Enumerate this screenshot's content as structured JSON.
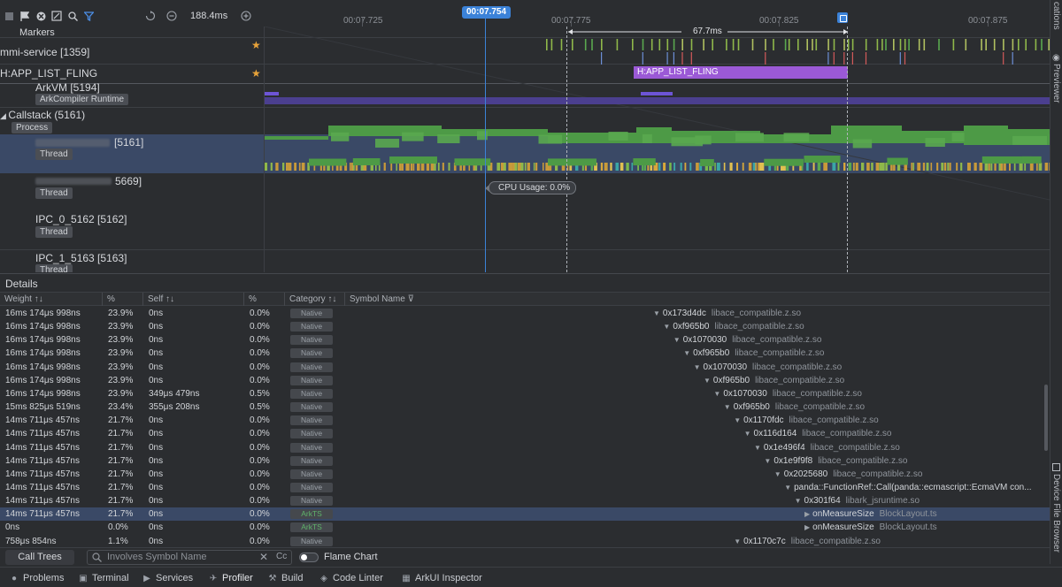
{
  "toolbar": {
    "zoom_value": "188.4ms",
    "icons": [
      "stop-icon",
      "flag-icon",
      "clear-icon",
      "fit-icon",
      "search-icon",
      "filter-icon",
      "reset-icon",
      "zoom-out-icon",
      "zoom-in-icon"
    ]
  },
  "ruler": {
    "cursor_time": "00:07.754",
    "ticks": [
      "00:07.725",
      "00:07.775",
      "00:07.825",
      "00:07.875"
    ],
    "duration": "67.7ms"
  },
  "lanes": {
    "markers": "Markers",
    "mmi_service": "mmi-service [1359]",
    "app_list_fling": "H:APP_LIST_FLING",
    "arkvm": "ArkVM [5194]",
    "arkvm_tag": "ArkCompiler Runtime",
    "callstack": "Callstack (5161)",
    "callstack_tag": "Process",
    "thread1_id": "[5161]",
    "thread1_tag": "Thread",
    "thread2_id": "5669]",
    "thread2_tag": "Thread",
    "ipc0": "IPC_0_5162 [5162]",
    "ipc0_tag": "Thread",
    "ipc1": "IPC_1_5163 [5163]",
    "ipc1_tag": "Thread"
  },
  "fling_label": "H:APP_LIST_FLING",
  "cpu_usage": "CPU Usage:  0.0%",
  "details": {
    "title": "Details",
    "columns": [
      "Weight ↑↓",
      "%",
      "Self ↑↓",
      "%",
      "Category ↑↓",
      "Symbol Name ⊽"
    ],
    "rows": [
      {
        "weight": "16ms 174μs 998ns",
        "pct": "23.9%",
        "self": "0ns",
        "spct": "0.0%",
        "cat": "Native",
        "sym": "0x173d4dc",
        "lib": "libace_compatible.z.so",
        "indent": 0
      },
      {
        "weight": "16ms 174μs 998ns",
        "pct": "23.9%",
        "self": "0ns",
        "spct": "0.0%",
        "cat": "Native",
        "sym": "0xf965b0",
        "lib": "libace_compatible.z.so",
        "indent": 1
      },
      {
        "weight": "16ms 174μs 998ns",
        "pct": "23.9%",
        "self": "0ns",
        "spct": "0.0%",
        "cat": "Native",
        "sym": "0x1070030",
        "lib": "libace_compatible.z.so",
        "indent": 2
      },
      {
        "weight": "16ms 174μs 998ns",
        "pct": "23.9%",
        "self": "0ns",
        "spct": "0.0%",
        "cat": "Native",
        "sym": "0xf965b0",
        "lib": "libace_compatible.z.so",
        "indent": 3
      },
      {
        "weight": "16ms 174μs 998ns",
        "pct": "23.9%",
        "self": "0ns",
        "spct": "0.0%",
        "cat": "Native",
        "sym": "0x1070030",
        "lib": "libace_compatible.z.so",
        "indent": 4
      },
      {
        "weight": "16ms 174μs 998ns",
        "pct": "23.9%",
        "self": "0ns",
        "spct": "0.0%",
        "cat": "Native",
        "sym": "0xf965b0",
        "lib": "libace_compatible.z.so",
        "indent": 5
      },
      {
        "weight": "16ms 174μs 998ns",
        "pct": "23.9%",
        "self": "349μs 479ns",
        "spct": "0.5%",
        "cat": "Native",
        "sym": "0x1070030",
        "lib": "libace_compatible.z.so",
        "indent": 6
      },
      {
        "weight": "15ms 825μs 519ns",
        "pct": "23.4%",
        "self": "355μs 208ns",
        "spct": "0.5%",
        "cat": "Native",
        "sym": "0xf965b0",
        "lib": "libace_compatible.z.so",
        "indent": 7
      },
      {
        "weight": "14ms 711μs 457ns",
        "pct": "21.7%",
        "self": "0ns",
        "spct": "0.0%",
        "cat": "Native",
        "sym": "0x1170fdc",
        "lib": "libace_compatible.z.so",
        "indent": 8
      },
      {
        "weight": "14ms 711μs 457ns",
        "pct": "21.7%",
        "self": "0ns",
        "spct": "0.0%",
        "cat": "Native",
        "sym": "0x116d164",
        "lib": "libace_compatible.z.so",
        "indent": 9
      },
      {
        "weight": "14ms 711μs 457ns",
        "pct": "21.7%",
        "self": "0ns",
        "spct": "0.0%",
        "cat": "Native",
        "sym": "0x1e496f4",
        "lib": "libace_compatible.z.so",
        "indent": 10
      },
      {
        "weight": "14ms 711μs 457ns",
        "pct": "21.7%",
        "self": "0ns",
        "spct": "0.0%",
        "cat": "Native",
        "sym": "0x1e9f9f8",
        "lib": "libace_compatible.z.so",
        "indent": 11
      },
      {
        "weight": "14ms 711μs 457ns",
        "pct": "21.7%",
        "self": "0ns",
        "spct": "0.0%",
        "cat": "Native",
        "sym": "0x2025680",
        "lib": "libace_compatible.z.so",
        "indent": 12
      },
      {
        "weight": "14ms 711μs 457ns",
        "pct": "21.7%",
        "self": "0ns",
        "spct": "0.0%",
        "cat": "Native",
        "sym": "panda::FunctionRef::Call(panda::ecmascript::EcmaVM con...",
        "lib": "",
        "indent": 13
      },
      {
        "weight": "14ms 711μs 457ns",
        "pct": "21.7%",
        "self": "0ns",
        "spct": "0.0%",
        "cat": "Native",
        "sym": "0x301f64",
        "lib": "libark_jsruntime.so",
        "indent": 14
      },
      {
        "weight": "14ms 711μs 457ns",
        "pct": "21.7%",
        "self": "0ns",
        "spct": "0.0%",
        "cat": "ArkTS",
        "sym": "onMeasureSize",
        "lib": "BlockLayout.ts",
        "indent": 15,
        "selected": true,
        "collapsed": true
      },
      {
        "weight": "0ns",
        "pct": "0.0%",
        "self": "0ns",
        "spct": "0.0%",
        "cat": "ArkTS",
        "sym": "onMeasureSize",
        "lib": "BlockLayout.ts",
        "indent": 15,
        "collapsed": true
      },
      {
        "weight": "758μs 854ns",
        "pct": "1.1%",
        "self": "0ns",
        "spct": "0.0%",
        "cat": "Native",
        "sym": "0x1170c7c",
        "lib": "libace_compatible.z.so",
        "indent": 8
      }
    ]
  },
  "call_trees": {
    "button": "Call Trees",
    "search_placeholder": "Involves Symbol Name",
    "cc": "Cc",
    "flame_chart": "Flame Chart"
  },
  "right_strip": {
    "top": "cations",
    "previewer": "Previewer",
    "device_file_browser": "Device File Browser"
  },
  "bottom_tabs": [
    {
      "label": "Problems",
      "icon": "problems-icon"
    },
    {
      "label": "Terminal",
      "icon": "terminal-icon"
    },
    {
      "label": "Services",
      "icon": "services-icon"
    },
    {
      "label": "Profiler",
      "icon": "profiler-icon",
      "active": true
    },
    {
      "label": "Build",
      "icon": "build-icon"
    },
    {
      "label": "Code Linter",
      "icon": "code-linter-icon"
    },
    {
      "label": "ArkUI Inspector",
      "icon": "arkui-inspector-icon"
    }
  ],
  "colors": {
    "accent": "#3b82d8",
    "fling": "#9b59d6",
    "green": "#5aa84f",
    "selection": "#3a4966"
  }
}
